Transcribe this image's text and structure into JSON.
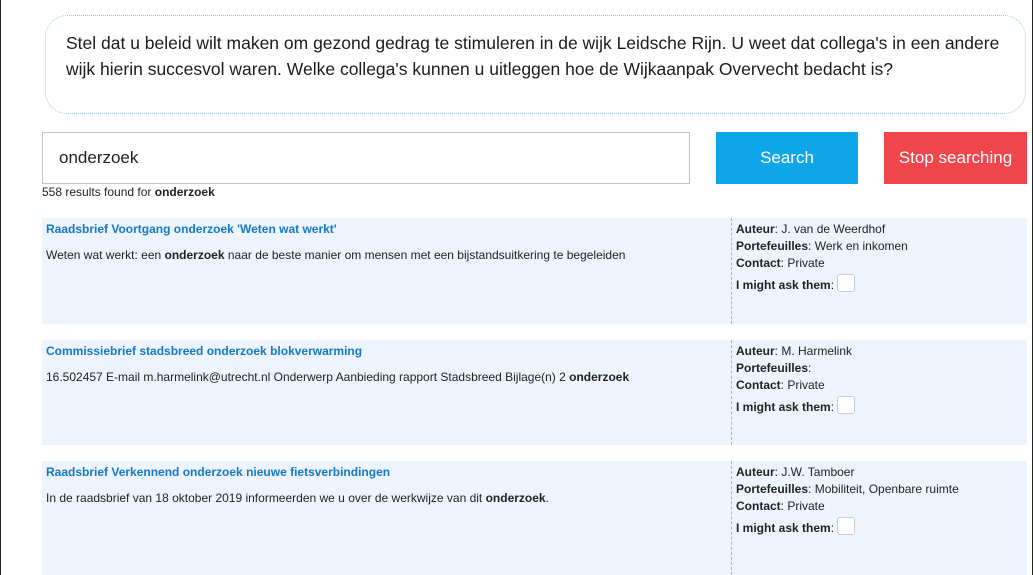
{
  "task": {
    "text": "Stel dat u beleid wilt maken om gezond gedrag te stimuleren in de wijk Leidsche Rijn. U weet dat collega's in een andere wijk hierin succesvol waren. Welke collega's kunnen u uitleggen hoe de Wijkaanpak Overvecht bedacht is?"
  },
  "search": {
    "query": "onderzoek",
    "search_label": "Search",
    "stop_label": "Stop searching"
  },
  "results_summary": {
    "count": "558",
    "text": "results found for",
    "term": "onderzoek"
  },
  "labels": {
    "author": "Auteur",
    "portfolios": "Portefeuilles",
    "contact": "Contact",
    "ask": "I might ask them"
  },
  "results": [
    {
      "title": "Raadsbrief Voortgang onderzoek 'Weten wat werkt'",
      "snippet_before": "Weten wat werkt: een ",
      "snippet_bold": "onderzoek",
      "snippet_after": " naar de beste manier om mensen met een bijstandsuitkering te begeleiden",
      "author": "J. van de Weerdhof",
      "portfolios": "Werk en inkomen",
      "contact": "Private"
    },
    {
      "title": "Commissiebrief stadsbreed onderzoek blokverwarming",
      "snippet_before": "16.502457 E-mail m.harmelink@utrecht.nl Onderwerp Aanbieding rapport Stadsbreed Bijlage(n) 2 ",
      "snippet_bold": "onderzoek",
      "snippet_after": "",
      "author": "M. Harmelink",
      "portfolios": "",
      "contact": "Private"
    },
    {
      "title": "Raadsbrief Verkennend onderzoek nieuwe fietsverbindingen",
      "snippet_before": "In de raadsbrief van 18 oktober 2019 informeerden we u over de werkwijze van dit ",
      "snippet_bold": "onderzoek",
      "snippet_after": ".",
      "author": "J.W. Tamboer",
      "portfolios": "Mobiliteit, Openbare ruimte",
      "contact": "Private"
    }
  ]
}
